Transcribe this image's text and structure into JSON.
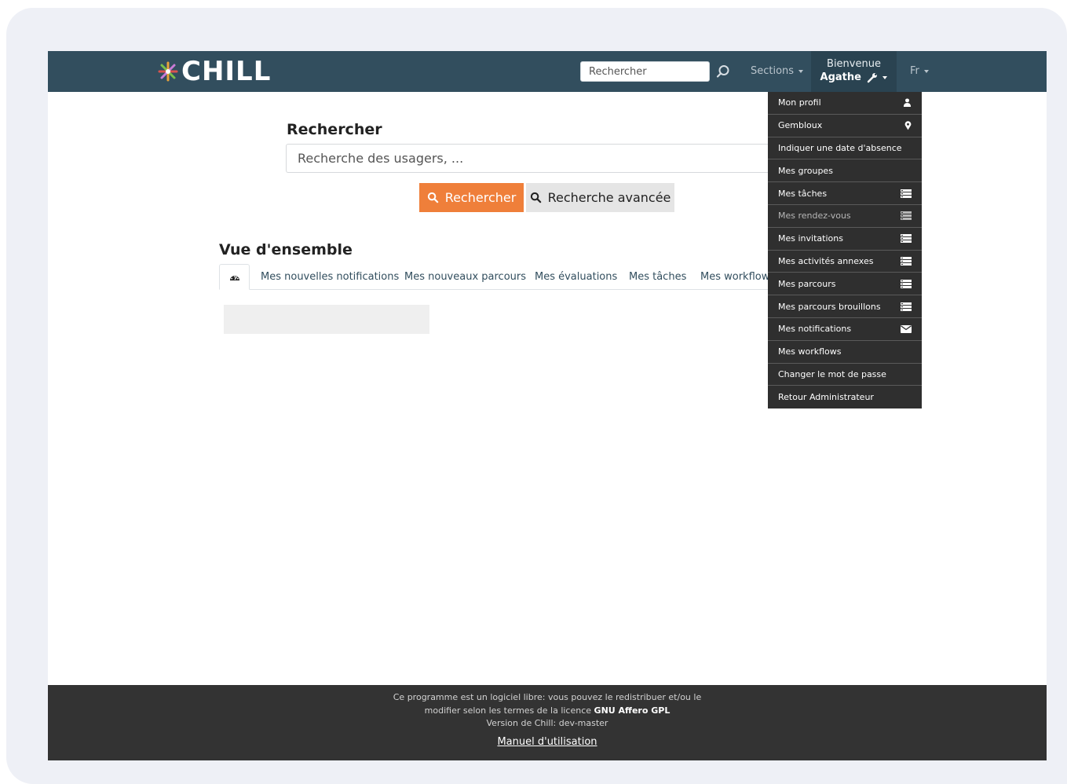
{
  "brand": {
    "name": "CHILL"
  },
  "navbar": {
    "search_placeholder": "Rechercher",
    "sections_label": "Sections",
    "welcome": "Bienvenue",
    "user_name": "Agathe",
    "lang": "Fr"
  },
  "search": {
    "title": "Rechercher",
    "input_placeholder": "Recherche des usagers, ...",
    "search_button": "Rechercher",
    "advanced_button": "Recherche avancée"
  },
  "overview": {
    "title": "Vue d'ensemble",
    "tabs": [
      {
        "label": "Mes nouvelles notifications"
      },
      {
        "label": "Mes nouveaux parcours"
      },
      {
        "label": "Mes évaluations"
      },
      {
        "label": "Mes tâches"
      },
      {
        "label": "Mes workflows"
      }
    ]
  },
  "user_menu": {
    "items": [
      {
        "label": "Mon profil",
        "icon": "user-icon"
      },
      {
        "label": "Gembloux",
        "icon": "map-marker-icon"
      },
      {
        "label": "Indiquer une date d'absence",
        "icon": ""
      },
      {
        "label": "Mes groupes",
        "icon": ""
      },
      {
        "label": "Mes tâches",
        "icon": "list-icon"
      },
      {
        "label": "Mes rendez-vous",
        "icon": "list-icon"
      },
      {
        "label": "Mes invitations",
        "icon": "list-icon"
      },
      {
        "label": "Mes activités annexes",
        "icon": "list-icon"
      },
      {
        "label": "Mes parcours",
        "icon": "list-icon"
      },
      {
        "label": "Mes parcours brouillons",
        "icon": "list-icon"
      },
      {
        "label": "Mes notifications",
        "icon": "envelope-icon"
      },
      {
        "label": "Mes workflows",
        "icon": ""
      },
      {
        "label": "Changer le mot de passe",
        "icon": ""
      },
      {
        "label": "Retour Administrateur",
        "icon": ""
      }
    ]
  },
  "footer": {
    "line1": "Ce programme est un logiciel libre: vous pouvez le redistribuer et/ou le",
    "line2_prefix": "modifier selon les termes de la licence",
    "license": "GNU Affero GPL",
    "version": "Version de Chill: dev-master",
    "manual": "Manuel d'utilisation"
  },
  "colors": {
    "navbar": "#324e5e",
    "accent_orange": "#ef7f3a",
    "dropdown_bg": "#2f2f2f",
    "footer_bg": "#333333"
  }
}
